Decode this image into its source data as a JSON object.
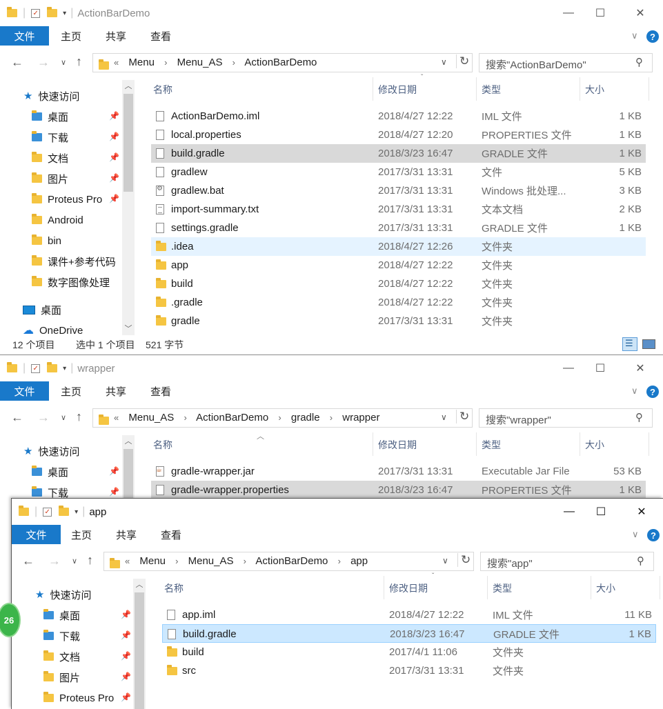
{
  "ribbon": {
    "file": "文件",
    "home": "主页",
    "share": "共享",
    "view": "查看"
  },
  "columns": {
    "name": "名称",
    "date": "修改日期",
    "type": "类型",
    "size": "大小"
  },
  "nav_pin": "📌",
  "w1": {
    "title": "ActionBarDemo",
    "breadcrumbs": [
      "Menu",
      "Menu_AS",
      "ActionBarDemo"
    ],
    "search_placeholder": "搜索\"ActionBarDemo\"",
    "nav": [
      {
        "label": "快速访问",
        "icon": "star-icon"
      },
      {
        "label": "桌面",
        "icon": "desktop-folder-icon",
        "pinned": true
      },
      {
        "label": "下载",
        "icon": "download-folder-icon",
        "pinned": true
      },
      {
        "label": "文档",
        "icon": "documents-folder-icon",
        "pinned": true
      },
      {
        "label": "图片",
        "icon": "pictures-folder-icon",
        "pinned": true
      },
      {
        "label": "Proteus Pro",
        "icon": "folder-icon",
        "pinned": true
      },
      {
        "label": "Android",
        "icon": "folder-icon"
      },
      {
        "label": "bin",
        "icon": "folder-icon"
      },
      {
        "label": "课件+参考代码",
        "icon": "folder-icon"
      },
      {
        "label": "数字图像处理",
        "icon": "folder-icon"
      },
      {
        "label": "桌面",
        "icon": "desktop-icon"
      },
      {
        "label": "OneDrive",
        "icon": "cloud-icon"
      }
    ],
    "files": [
      {
        "name": "ActionBarDemo.iml",
        "date": "2018/4/27 12:22",
        "type": "IML 文件",
        "size": "1 KB",
        "icon": "file-icon"
      },
      {
        "name": "local.properties",
        "date": "2018/4/27 12:20",
        "type": "PROPERTIES 文件",
        "size": "1 KB",
        "icon": "file-icon"
      },
      {
        "name": "build.gradle",
        "date": "2018/3/23 16:47",
        "type": "GRADLE 文件",
        "size": "1 KB",
        "icon": "file-icon",
        "state": "sel"
      },
      {
        "name": "gradlew",
        "date": "2017/3/31 13:31",
        "type": "文件",
        "size": "5 KB",
        "icon": "file-icon"
      },
      {
        "name": "gradlew.bat",
        "date": "2017/3/31 13:31",
        "type": "Windows 批处理...",
        "size": "3 KB",
        "icon": "batch-file-icon"
      },
      {
        "name": "import-summary.txt",
        "date": "2017/3/31 13:31",
        "type": "文本文档",
        "size": "2 KB",
        "icon": "text-file-icon"
      },
      {
        "name": "settings.gradle",
        "date": "2017/3/31 13:31",
        "type": "GRADLE 文件",
        "size": "1 KB",
        "icon": "file-icon"
      },
      {
        "name": ".idea",
        "date": "2018/4/27 12:26",
        "type": "文件夹",
        "size": "",
        "icon": "folder-icon",
        "state": "hover"
      },
      {
        "name": "app",
        "date": "2018/4/27 12:22",
        "type": "文件夹",
        "size": "",
        "icon": "folder-icon"
      },
      {
        "name": "build",
        "date": "2018/4/27 12:22",
        "type": "文件夹",
        "size": "",
        "icon": "folder-icon"
      },
      {
        "name": ".gradle",
        "date": "2018/4/27 12:22",
        "type": "文件夹",
        "size": "",
        "icon": "folder-icon"
      },
      {
        "name": "gradle",
        "date": "2017/3/31 13:31",
        "type": "文件夹",
        "size": "",
        "icon": "folder-icon"
      }
    ],
    "status": {
      "count": "12 个项目",
      "selected": "选中 1 个项目",
      "bytes": "521 字节"
    }
  },
  "w2": {
    "title": "wrapper",
    "breadcrumbs": [
      "Menu_AS",
      "ActionBarDemo",
      "gradle",
      "wrapper"
    ],
    "search_placeholder": "搜索\"wrapper\"",
    "nav": [
      {
        "label": "快速访问",
        "icon": "star-icon"
      },
      {
        "label": "桌面",
        "icon": "desktop-folder-icon",
        "pinned": true
      },
      {
        "label": "下载",
        "icon": "download-folder-icon",
        "pinned": true
      }
    ],
    "files": [
      {
        "name": "gradle-wrapper.jar",
        "date": "2017/3/31 13:31",
        "type": "Executable Jar File",
        "size": "53 KB",
        "icon": "jar-file-icon"
      },
      {
        "name": "gradle-wrapper.properties",
        "date": "2018/3/23 16:47",
        "type": "PROPERTIES 文件",
        "size": "1 KB",
        "icon": "file-icon",
        "state": "sel"
      }
    ]
  },
  "w3": {
    "title": "app",
    "breadcrumbs": [
      "Menu",
      "Menu_AS",
      "ActionBarDemo",
      "app"
    ],
    "search_placeholder": "搜索\"app\"",
    "nav": [
      {
        "label": "快速访问",
        "icon": "star-icon"
      },
      {
        "label": "桌面",
        "icon": "desktop-folder-icon",
        "pinned": true
      },
      {
        "label": "下载",
        "icon": "download-folder-icon",
        "pinned": true
      },
      {
        "label": "文档",
        "icon": "documents-folder-icon",
        "pinned": true
      },
      {
        "label": "图片",
        "icon": "pictures-folder-icon",
        "pinned": true
      },
      {
        "label": "Proteus Pro",
        "icon": "folder-icon",
        "pinned": true
      }
    ],
    "files": [
      {
        "name": "app.iml",
        "date": "2018/4/27 12:22",
        "type": "IML 文件",
        "size": "11 KB",
        "icon": "file-icon"
      },
      {
        "name": "build.gradle",
        "date": "2018/3/23 16:47",
        "type": "GRADLE 文件",
        "size": "1 KB",
        "icon": "file-icon",
        "state": "focus"
      },
      {
        "name": "build",
        "date": "2017/4/1 11:06",
        "type": "文件夹",
        "size": "",
        "icon": "folder-icon"
      },
      {
        "name": "src",
        "date": "2017/3/31 13:31",
        "type": "文件夹",
        "size": "",
        "icon": "folder-icon"
      }
    ]
  },
  "badge": "26",
  "colors": {
    "accent": "#1979ca",
    "selected_row": "#d9d9d9",
    "hover_row": "#e5f3ff",
    "focus_row": "#cce8ff"
  }
}
